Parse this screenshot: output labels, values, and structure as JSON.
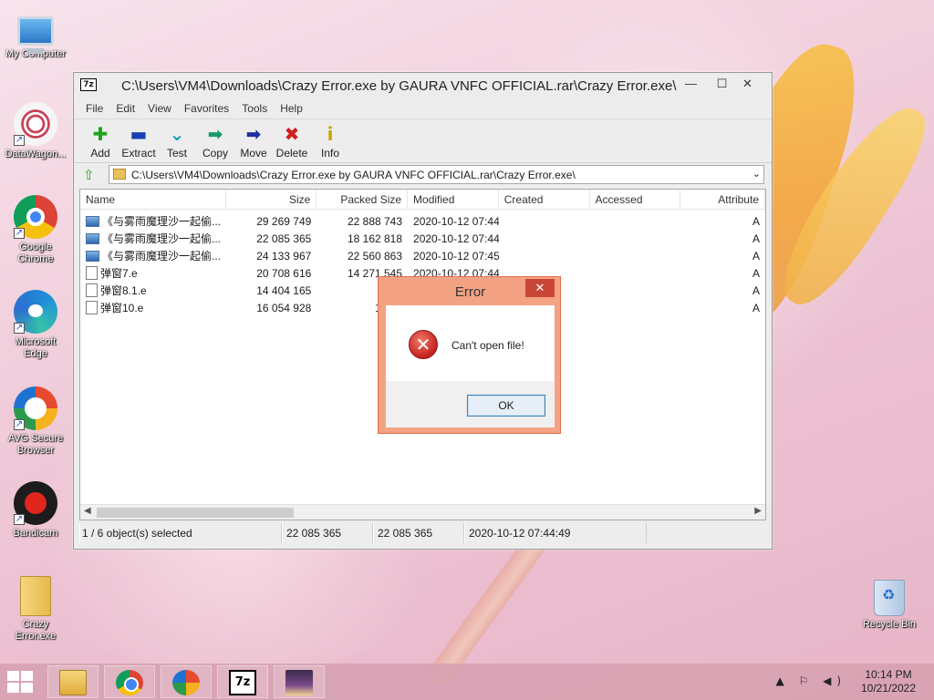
{
  "desktop": {
    "icons": [
      {
        "label": "My Computer"
      },
      {
        "label": "DataWagon..."
      },
      {
        "label": "Google Chrome"
      },
      {
        "label": "Microsoft Edge"
      },
      {
        "label": "AVG Secure Browser"
      },
      {
        "label": "Bandicam"
      },
      {
        "label": "Crazy Error.exe"
      },
      {
        "label": "Recycle Bin"
      }
    ]
  },
  "window": {
    "app_icon": "7z",
    "title": "C:\\Users\\VM4\\Downloads\\Crazy Error.exe by GAURA VNFC OFFICIAL.rar\\Crazy Error.exe\\",
    "controls": {
      "minimize": "—",
      "maximize": "☐",
      "close": "✕"
    },
    "menu": [
      "File",
      "Edit",
      "View",
      "Favorites",
      "Tools",
      "Help"
    ],
    "toolbar": [
      {
        "label": "Add",
        "icon": "add-icon",
        "glyph": "✚",
        "color": "#1fa31f"
      },
      {
        "label": "Extract",
        "icon": "extract-icon",
        "glyph": "▬",
        "color": "#1d3fb5"
      },
      {
        "label": "Test",
        "icon": "test-icon",
        "glyph": "⌄",
        "color": "#1fa0b8"
      },
      {
        "label": "Copy",
        "icon": "copy-icon",
        "glyph": "➡",
        "color": "#1d9a6a"
      },
      {
        "label": "Move",
        "icon": "move-icon",
        "glyph": "➡",
        "color": "#1d2fa0"
      },
      {
        "label": "Delete",
        "icon": "delete-icon",
        "glyph": "✖",
        "color": "#d0201c"
      },
      {
        "label": "Info",
        "icon": "info-icon",
        "glyph": "i",
        "color": "#c9a400"
      }
    ],
    "address": "C:\\Users\\VM4\\Downloads\\Crazy Error.exe by GAURA VNFC OFFICIAL.rar\\Crazy Error.exe\\",
    "columns": {
      "name": "Name",
      "size": "Size",
      "packed": "Packed Size",
      "modified": "Modified",
      "created": "Created",
      "accessed": "Accessed",
      "attributes": "Attribute"
    },
    "files": [
      {
        "name": "《与雾雨魔理沙一起偷...",
        "size": "29 269 749",
        "packed": "22 888 743",
        "modified": "2020-10-12 07:44",
        "icon": "image",
        "attr": "A"
      },
      {
        "name": "《与雾雨魔理沙一起偷...",
        "size": "22 085 365",
        "packed": "18 162 818",
        "modified": "2020-10-12 07:44",
        "icon": "image",
        "attr": "A"
      },
      {
        "name": "《与雾雨魔理沙一起偷...",
        "size": "24 133 967",
        "packed": "22 560 863",
        "modified": "2020-10-12 07:45",
        "icon": "image",
        "attr": "A"
      },
      {
        "name": "弹窗7.e",
        "size": "20 708 616",
        "packed": "14 271 545",
        "modified": "2020-10-12 07:44",
        "icon": "file",
        "attr": "A"
      },
      {
        "name": "弹窗8.1.e",
        "size": "14 404 165",
        "packed": "9 92",
        "modified": "",
        "icon": "file",
        "attr": "A"
      },
      {
        "name": "弹窗10.e",
        "size": "16 054 928",
        "packed": "14 43",
        "modified": "",
        "icon": "file",
        "attr": "A"
      }
    ],
    "status": {
      "selection": "1 / 6 object(s) selected",
      "size": "22 085 365",
      "packed": "22 085 365",
      "modified": "2020-10-12 07:44:49"
    }
  },
  "dialog": {
    "title": "Error",
    "close": "✕",
    "message": "Can't open file!",
    "ok": "OK"
  },
  "taskbar": {
    "clock_time": "10:14 PM",
    "clock_date": "10/21/2022",
    "tray": "▲ ⚐ ◀)"
  }
}
